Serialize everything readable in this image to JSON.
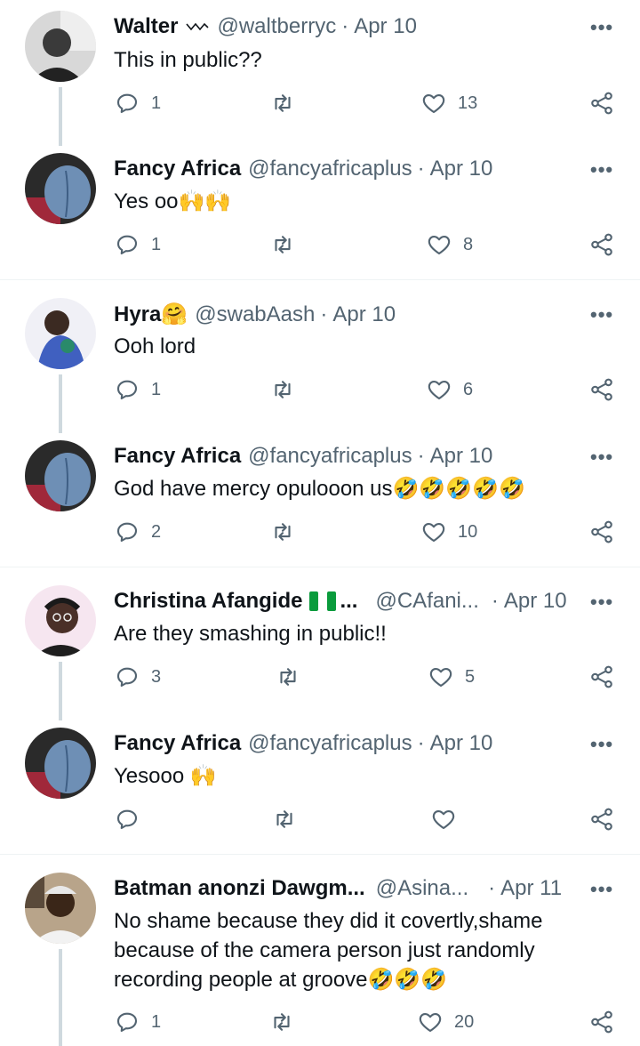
{
  "colors": {
    "text": "#0f1419",
    "muted": "#536471",
    "line": "#cfd9de",
    "divider": "#eff3f4"
  },
  "more_label": "•••",
  "tweets": [
    {
      "name": "Walter",
      "badge_icon": "squiggle-icon",
      "handle": "@waltberryc",
      "dot": "·",
      "date": "Apr 10",
      "text": "This in public??",
      "replies": "1",
      "retweets": "",
      "likes": "13"
    },
    {
      "name": "Fancy Africa",
      "handle": "@fancyafricaplus",
      "dot": "·",
      "date": "Apr 10",
      "text": "Yes oo🙌🙌",
      "replies": "1",
      "retweets": "",
      "likes": "8"
    },
    {
      "name": "Hyra🤗",
      "handle": "@swabAash",
      "dot": "·",
      "date": "Apr 10",
      "text": "Ooh lord",
      "replies": "1",
      "retweets": "",
      "likes": "6"
    },
    {
      "name": "Fancy Africa",
      "handle": "@fancyafricaplus",
      "dot": "·",
      "date": "Apr 10",
      "text": "God have mercy opulooon us🤣🤣🤣🤣🤣",
      "replies": "2",
      "retweets": "",
      "likes": "10"
    },
    {
      "name": "Christina Afangide",
      "badge_icon": "nigeria-flag-icon",
      "ellipsis": "...",
      "handle": "@CAfani...",
      "dot": "·",
      "date": "Apr 10",
      "text": "Are they smashing in public!!",
      "replies": "3",
      "retweets": "",
      "likes": "5"
    },
    {
      "name": "Fancy Africa",
      "handle": "@fancyafricaplus",
      "dot": "·",
      "date": "Apr 10",
      "text": "Yesooo 🙌",
      "replies": "",
      "retweets": "",
      "likes": ""
    },
    {
      "name": "Batman anonzi Dawgm...",
      "handle": "@Asina...",
      "dot": "·",
      "date": "Apr 11",
      "text": "No shame because they did it covertly,shame because of the camera person just randomly recording people at groove🤣🤣🤣",
      "replies": "1",
      "retweets": "",
      "likes": "20"
    }
  ]
}
